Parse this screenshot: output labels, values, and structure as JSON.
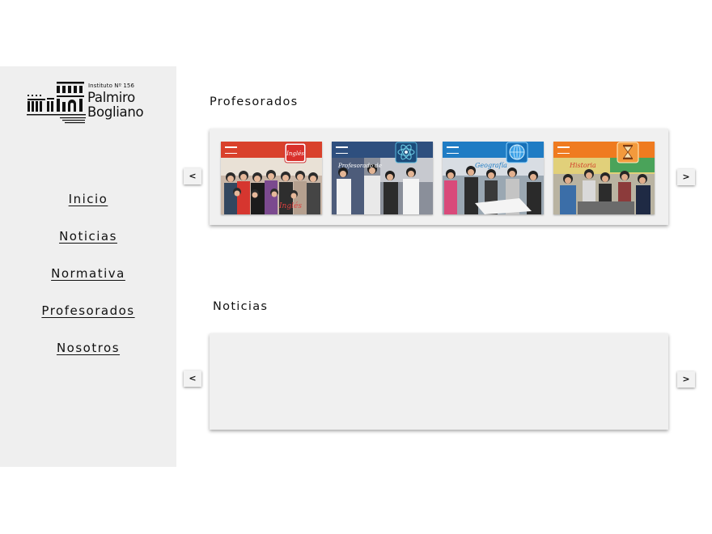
{
  "brand": {
    "institute": "Instituto Nº 156",
    "name_line1": "Palmiro",
    "name_line2": "Bogliano"
  },
  "nav": {
    "items": [
      {
        "label": "Inicio"
      },
      {
        "label": "Noticias"
      },
      {
        "label": "Normativa"
      },
      {
        "label": "Profesorados"
      },
      {
        "label": "Nosotros"
      }
    ]
  },
  "profesorados": {
    "title": "Profesorados",
    "prev": "<",
    "next": ">",
    "cards": [
      {
        "banner_color": "#d9412c",
        "badge": "Inglés",
        "icon": "flag-badge-icon"
      },
      {
        "banner_color": "#2e4f7e",
        "badge": "",
        "icon": "atom-badge-icon"
      },
      {
        "banner_color": "#1f7cc4",
        "badge": "",
        "icon": "globe-badge-icon"
      },
      {
        "banner_color": "#ef7b20",
        "badge": "",
        "icon": "hourglass-badge-icon"
      }
    ]
  },
  "noticias": {
    "title": "Noticias",
    "prev": "<",
    "next": ">"
  }
}
